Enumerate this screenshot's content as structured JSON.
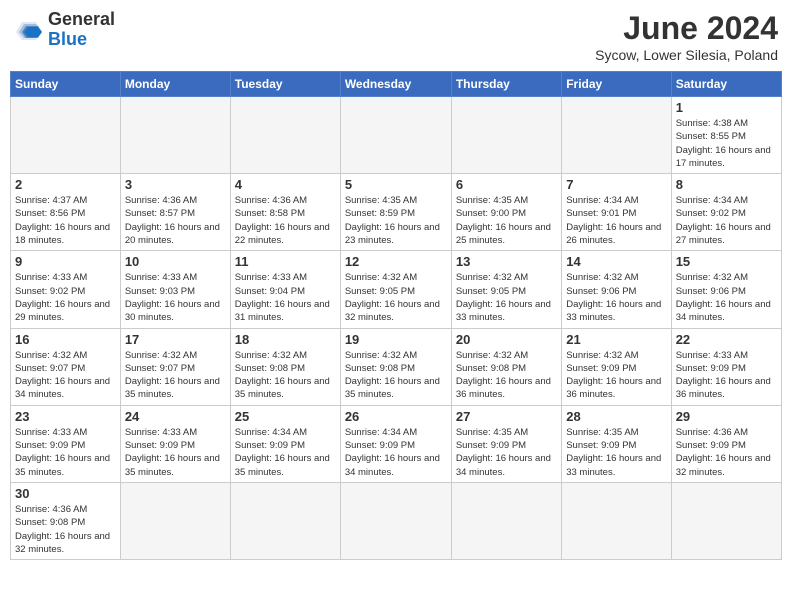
{
  "logo": {
    "text_general": "General",
    "text_blue": "Blue"
  },
  "title": "June 2024",
  "subtitle": "Sycow, Lower Silesia, Poland",
  "weekdays": [
    "Sunday",
    "Monday",
    "Tuesday",
    "Wednesday",
    "Thursday",
    "Friday",
    "Saturday"
  ],
  "weeks": [
    [
      {
        "day": "",
        "info": ""
      },
      {
        "day": "",
        "info": ""
      },
      {
        "day": "",
        "info": ""
      },
      {
        "day": "",
        "info": ""
      },
      {
        "day": "",
        "info": ""
      },
      {
        "day": "",
        "info": ""
      },
      {
        "day": "1",
        "info": "Sunrise: 4:38 AM\nSunset: 8:55 PM\nDaylight: 16 hours and 17 minutes."
      }
    ],
    [
      {
        "day": "2",
        "info": "Sunrise: 4:37 AM\nSunset: 8:56 PM\nDaylight: 16 hours and 18 minutes."
      },
      {
        "day": "3",
        "info": "Sunrise: 4:36 AM\nSunset: 8:57 PM\nDaylight: 16 hours and 20 minutes."
      },
      {
        "day": "4",
        "info": "Sunrise: 4:36 AM\nSunset: 8:58 PM\nDaylight: 16 hours and 22 minutes."
      },
      {
        "day": "5",
        "info": "Sunrise: 4:35 AM\nSunset: 8:59 PM\nDaylight: 16 hours and 23 minutes."
      },
      {
        "day": "6",
        "info": "Sunrise: 4:35 AM\nSunset: 9:00 PM\nDaylight: 16 hours and 25 minutes."
      },
      {
        "day": "7",
        "info": "Sunrise: 4:34 AM\nSunset: 9:01 PM\nDaylight: 16 hours and 26 minutes."
      },
      {
        "day": "8",
        "info": "Sunrise: 4:34 AM\nSunset: 9:02 PM\nDaylight: 16 hours and 27 minutes."
      }
    ],
    [
      {
        "day": "9",
        "info": "Sunrise: 4:33 AM\nSunset: 9:02 PM\nDaylight: 16 hours and 29 minutes."
      },
      {
        "day": "10",
        "info": "Sunrise: 4:33 AM\nSunset: 9:03 PM\nDaylight: 16 hours and 30 minutes."
      },
      {
        "day": "11",
        "info": "Sunrise: 4:33 AM\nSunset: 9:04 PM\nDaylight: 16 hours and 31 minutes."
      },
      {
        "day": "12",
        "info": "Sunrise: 4:32 AM\nSunset: 9:05 PM\nDaylight: 16 hours and 32 minutes."
      },
      {
        "day": "13",
        "info": "Sunrise: 4:32 AM\nSunset: 9:05 PM\nDaylight: 16 hours and 33 minutes."
      },
      {
        "day": "14",
        "info": "Sunrise: 4:32 AM\nSunset: 9:06 PM\nDaylight: 16 hours and 33 minutes."
      },
      {
        "day": "15",
        "info": "Sunrise: 4:32 AM\nSunset: 9:06 PM\nDaylight: 16 hours and 34 minutes."
      }
    ],
    [
      {
        "day": "16",
        "info": "Sunrise: 4:32 AM\nSunset: 9:07 PM\nDaylight: 16 hours and 34 minutes."
      },
      {
        "day": "17",
        "info": "Sunrise: 4:32 AM\nSunset: 9:07 PM\nDaylight: 16 hours and 35 minutes."
      },
      {
        "day": "18",
        "info": "Sunrise: 4:32 AM\nSunset: 9:08 PM\nDaylight: 16 hours and 35 minutes."
      },
      {
        "day": "19",
        "info": "Sunrise: 4:32 AM\nSunset: 9:08 PM\nDaylight: 16 hours and 35 minutes."
      },
      {
        "day": "20",
        "info": "Sunrise: 4:32 AM\nSunset: 9:08 PM\nDaylight: 16 hours and 36 minutes."
      },
      {
        "day": "21",
        "info": "Sunrise: 4:32 AM\nSunset: 9:09 PM\nDaylight: 16 hours and 36 minutes."
      },
      {
        "day": "22",
        "info": "Sunrise: 4:33 AM\nSunset: 9:09 PM\nDaylight: 16 hours and 36 minutes."
      }
    ],
    [
      {
        "day": "23",
        "info": "Sunrise: 4:33 AM\nSunset: 9:09 PM\nDaylight: 16 hours and 35 minutes."
      },
      {
        "day": "24",
        "info": "Sunrise: 4:33 AM\nSunset: 9:09 PM\nDaylight: 16 hours and 35 minutes."
      },
      {
        "day": "25",
        "info": "Sunrise: 4:34 AM\nSunset: 9:09 PM\nDaylight: 16 hours and 35 minutes."
      },
      {
        "day": "26",
        "info": "Sunrise: 4:34 AM\nSunset: 9:09 PM\nDaylight: 16 hours and 34 minutes."
      },
      {
        "day": "27",
        "info": "Sunrise: 4:35 AM\nSunset: 9:09 PM\nDaylight: 16 hours and 34 minutes."
      },
      {
        "day": "28",
        "info": "Sunrise: 4:35 AM\nSunset: 9:09 PM\nDaylight: 16 hours and 33 minutes."
      },
      {
        "day": "29",
        "info": "Sunrise: 4:36 AM\nSunset: 9:09 PM\nDaylight: 16 hours and 32 minutes."
      }
    ],
    [
      {
        "day": "30",
        "info": "Sunrise: 4:36 AM\nSunset: 9:08 PM\nDaylight: 16 hours and 32 minutes."
      },
      {
        "day": "",
        "info": ""
      },
      {
        "day": "",
        "info": ""
      },
      {
        "day": "",
        "info": ""
      },
      {
        "day": "",
        "info": ""
      },
      {
        "day": "",
        "info": ""
      },
      {
        "day": "",
        "info": ""
      }
    ]
  ]
}
